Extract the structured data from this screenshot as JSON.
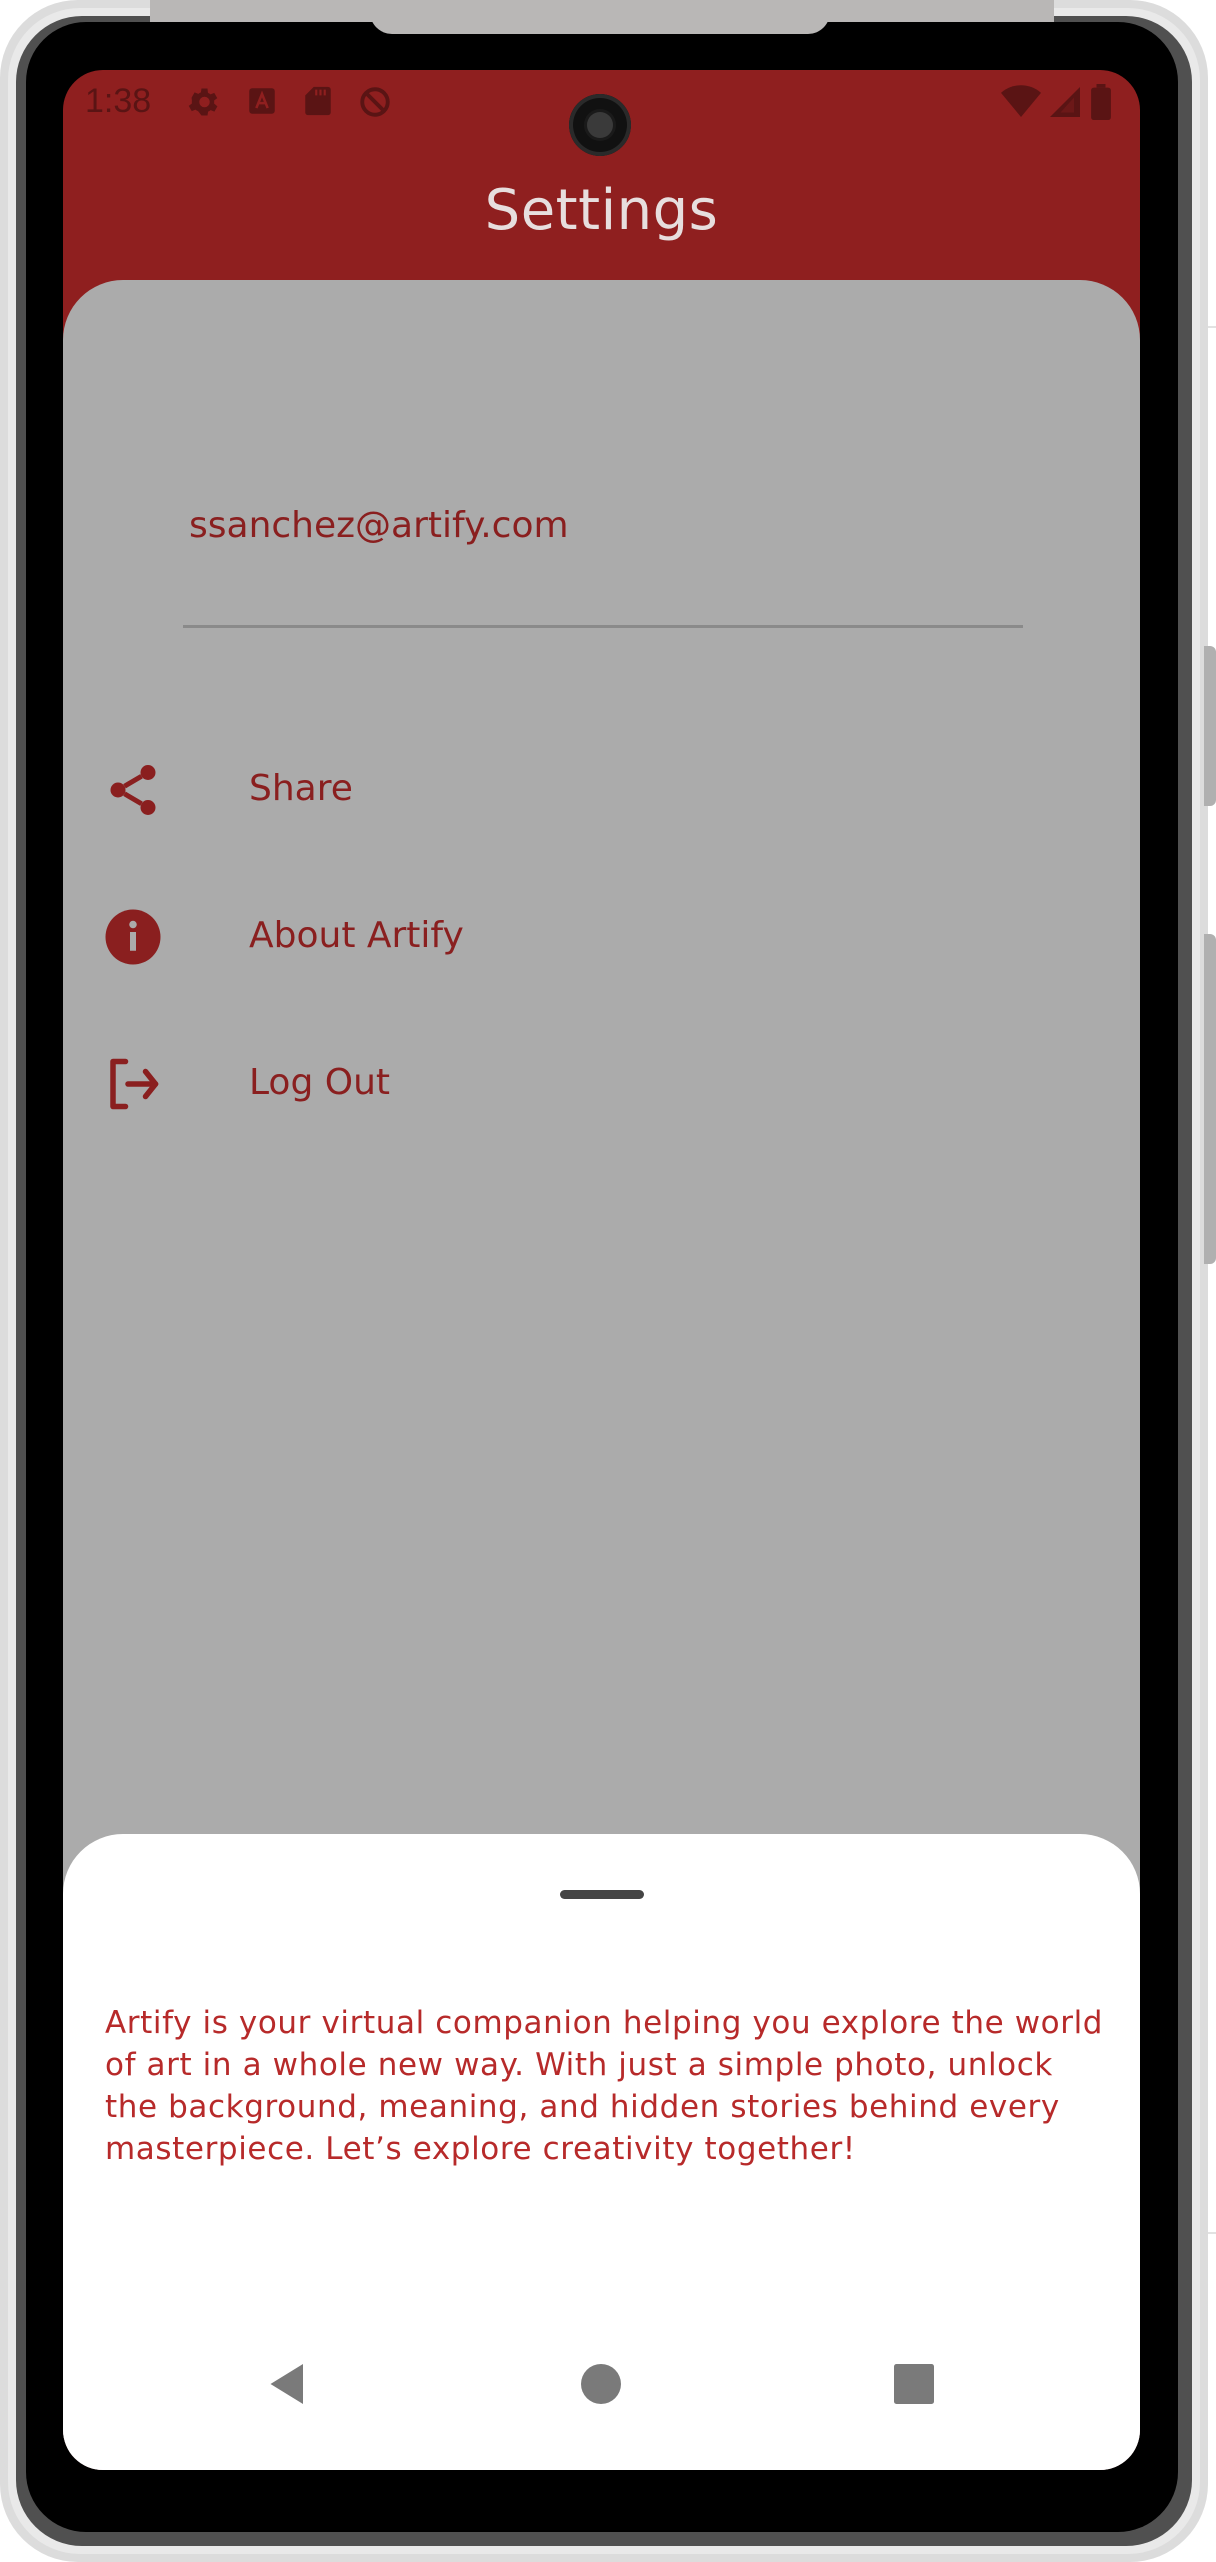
{
  "status_bar": {
    "time": "1:38",
    "left_icons": [
      "settings-icon",
      "keyboard-icon",
      "sd-card-icon",
      "no-sync-icon"
    ],
    "right_icons": [
      "wifi-icon",
      "signal-icon",
      "battery-icon"
    ]
  },
  "app_bar": {
    "title": "Settings"
  },
  "account": {
    "email": "ssanchez@artify.com"
  },
  "menu": [
    {
      "label": "Share",
      "icon": "share-icon"
    },
    {
      "label": "About Artify",
      "icon": "info-icon"
    },
    {
      "label": "Log Out",
      "icon": "logout-icon"
    }
  ],
  "about_sheet": {
    "text": "Artify is your virtual companion helping you explore the world of art in a whole new way. With just a simple photo, unlock the background, meaning, and hidden stories behind every masterpiece. Let’s explore creativity together!"
  },
  "nav": [
    "back-icon",
    "home-icon",
    "recents-icon"
  ],
  "colors": {
    "primary": "#8f1f1f",
    "accent_text": "#b72a2a",
    "scrim": "#ababab",
    "sheet": "#ffffff"
  }
}
